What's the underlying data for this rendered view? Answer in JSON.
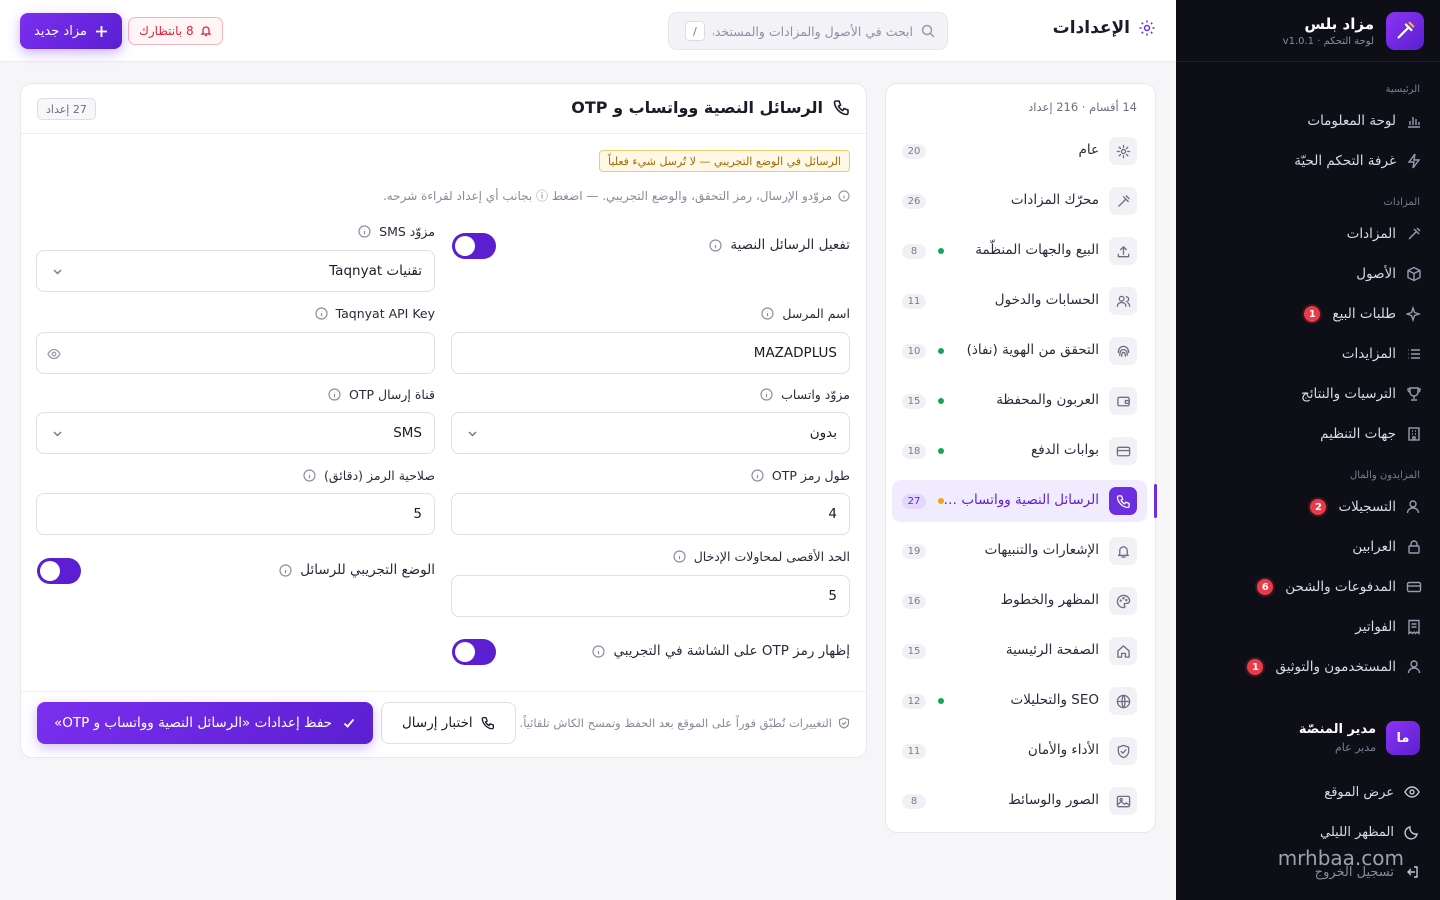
{
  "brand": {
    "name": "مزاد بلس",
    "subtitle": "لوحة التحكم · v1.0.1"
  },
  "sidebar": {
    "sections": [
      {
        "title": "الرئيسية",
        "items": [
          {
            "label": "لوحة المعلومات",
            "icon": "chart-bar-icon",
            "badge": ""
          },
          {
            "label": "غرفة التحكم الحيّة",
            "icon": "lightning-icon",
            "badge": ""
          }
        ]
      },
      {
        "title": "المزادات",
        "items": [
          {
            "label": "المزادات",
            "icon": "gavel-icon",
            "badge": ""
          },
          {
            "label": "الأصول",
            "icon": "box-icon",
            "badge": ""
          },
          {
            "label": "طلبات البيع",
            "icon": "sparkle-icon",
            "badge": "1"
          },
          {
            "label": "المزايدات",
            "icon": "list-icon",
            "badge": ""
          },
          {
            "label": "الترسيات والنتائج",
            "icon": "trophy-icon",
            "badge": ""
          },
          {
            "label": "جهات التنظيم",
            "icon": "building-icon",
            "badge": ""
          }
        ]
      },
      {
        "title": "المزايدون والمال",
        "items": [
          {
            "label": "التسجيلات",
            "icon": "user-plus-icon",
            "badge": "2"
          },
          {
            "label": "العرابين",
            "icon": "lock-icon",
            "badge": ""
          },
          {
            "label": "المدفوعات والشحن",
            "icon": "credit-card-icon",
            "badge": "6"
          },
          {
            "label": "الفواتير",
            "icon": "receipt-icon",
            "badge": ""
          },
          {
            "label": "المستخدمون والتوثيق",
            "icon": "user-icon",
            "badge": "1"
          }
        ]
      }
    ],
    "user": {
      "initials": "ما",
      "name": "مدير المنصّة",
      "role": "مدير عام"
    },
    "links": {
      "view_site": "عرض الموقع",
      "dark_mode": "المظهر الليلي",
      "logout": "تسجيل الخروج"
    },
    "watermark": "mrhbaa.com"
  },
  "topbar": {
    "title": "الإعدادات",
    "search_placeholder": "ابحث في الأصول والمزادات والمستخدمين…",
    "search_shortcut": "/",
    "pending_label": "8 بانتظارك",
    "new_auction_label": "مزاد جديد"
  },
  "categories": {
    "summary": "14 أقسام · 216 إعداد",
    "items": [
      {
        "label": "عام",
        "icon": "gear-icon",
        "count": "20",
        "dot": false,
        "active": false
      },
      {
        "label": "محرّك المزادات",
        "icon": "gavel-icon",
        "count": "26",
        "dot": false,
        "active": false
      },
      {
        "label": "البيع والجهات المنظّمة",
        "icon": "upload-icon",
        "count": "8",
        "dot": true,
        "active": false
      },
      {
        "label": "الحسابات والدخول",
        "icon": "users-icon",
        "count": "11",
        "dot": false,
        "active": false
      },
      {
        "label": "التحقق من الهوية (نفاذ)",
        "icon": "fingerprint-icon",
        "count": "10",
        "dot": true,
        "active": false
      },
      {
        "label": "العربون والمحفظة",
        "icon": "wallet-icon",
        "count": "15",
        "dot": true,
        "active": false
      },
      {
        "label": "بوابات الدفع",
        "icon": "credit-card-icon",
        "count": "18",
        "dot": true,
        "active": false
      },
      {
        "label": "الرسائل النصية وواتساب …",
        "icon": "phone-icon",
        "count": "27",
        "dot": true,
        "active": true
      },
      {
        "label": "الإشعارات والتنبيهات",
        "icon": "bell-icon",
        "count": "19",
        "dot": false,
        "active": false
      },
      {
        "label": "المظهر والخطوط",
        "icon": "palette-icon",
        "count": "16",
        "dot": false,
        "active": false
      },
      {
        "label": "الصفحة الرئيسية",
        "icon": "home-icon",
        "count": "15",
        "dot": false,
        "active": false
      },
      {
        "label": "SEO والتحليلات",
        "icon": "globe-icon",
        "count": "12",
        "dot": true,
        "active": false
      },
      {
        "label": "الأداء والأمان",
        "icon": "shield-icon",
        "count": "11",
        "dot": false,
        "active": false
      },
      {
        "label": "الصور والوسائط",
        "icon": "image-icon",
        "count": "8",
        "dot": false,
        "active": false
      }
    ]
  },
  "main": {
    "title": "الرسائل النصية وواتساب و OTP",
    "count_tag": "27 إعداد",
    "test_mode_badge": "الرسائل في الوضع التجريبي — لا تُرسل شيء فعلياً",
    "hint": "مزوّدو الإرسال، رمز التحقق، والوضع التجريبي. — اضغط  ⓘ  بجانب أي إعداد لقراءة شرحه.",
    "fields": {
      "enable_sms": {
        "label": "تفعيل الرسائل النصية",
        "on": true
      },
      "sms_provider": {
        "label": "مزوّد SMS",
        "value": "تقنيات Taqnyat"
      },
      "sender_name": {
        "label": "اسم المرسل",
        "value": "MAZADPLUS"
      },
      "api_key": {
        "label": "Taqnyat API Key",
        "value": ""
      },
      "whatsapp_provider": {
        "label": "مزوّد واتساب",
        "value": "بدون"
      },
      "otp_channel": {
        "label": "قناة إرسال OTP",
        "value": "SMS"
      },
      "otp_length": {
        "label": "طول رمز OTP",
        "value": "4"
      },
      "code_validity": {
        "label": "صلاحية الرمز (دقائق)",
        "value": "5"
      },
      "max_attempts": {
        "label": "الحد الأقصى لمحاولات الإدخال",
        "value": "5"
      },
      "test_mode": {
        "label": "الوضع التجريبي للرسائل",
        "on": true
      },
      "show_otp": {
        "label": "إظهار رمز OTP على الشاشة في التجريبي",
        "on": true
      }
    },
    "footer_note": "التغييرات تُطبّق فوراً على الموقع بعد الحفظ وتمسح الكاش تلقائياً.",
    "test_button": "اختبار إرسال",
    "save_button": "حفظ إعدادات «الرسائل النصية وواتساب و OTP»"
  },
  "colors": {
    "accent": "#6b2fe0",
    "sidebar_bg": "#0e0e17",
    "badge_red": "#ea3b4b",
    "dot_green": "#18a35a",
    "dot_amber": "#f0a313"
  }
}
